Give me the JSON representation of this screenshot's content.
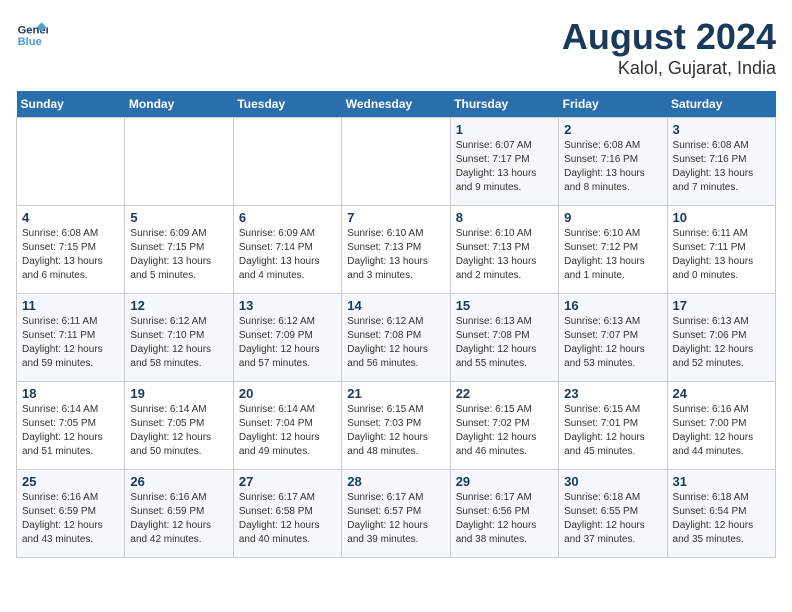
{
  "header": {
    "logo_line1": "General",
    "logo_line2": "Blue",
    "title": "August 2024",
    "subtitle": "Kalol, Gujarat, India"
  },
  "weekdays": [
    "Sunday",
    "Monday",
    "Tuesday",
    "Wednesday",
    "Thursday",
    "Friday",
    "Saturday"
  ],
  "weeks": [
    [
      {
        "day": "",
        "info": ""
      },
      {
        "day": "",
        "info": ""
      },
      {
        "day": "",
        "info": ""
      },
      {
        "day": "",
        "info": ""
      },
      {
        "day": "1",
        "info": "Sunrise: 6:07 AM\nSunset: 7:17 PM\nDaylight: 13 hours\nand 9 minutes."
      },
      {
        "day": "2",
        "info": "Sunrise: 6:08 AM\nSunset: 7:16 PM\nDaylight: 13 hours\nand 8 minutes."
      },
      {
        "day": "3",
        "info": "Sunrise: 6:08 AM\nSunset: 7:16 PM\nDaylight: 13 hours\nand 7 minutes."
      }
    ],
    [
      {
        "day": "4",
        "info": "Sunrise: 6:08 AM\nSunset: 7:15 PM\nDaylight: 13 hours\nand 6 minutes."
      },
      {
        "day": "5",
        "info": "Sunrise: 6:09 AM\nSunset: 7:15 PM\nDaylight: 13 hours\nand 5 minutes."
      },
      {
        "day": "6",
        "info": "Sunrise: 6:09 AM\nSunset: 7:14 PM\nDaylight: 13 hours\nand 4 minutes."
      },
      {
        "day": "7",
        "info": "Sunrise: 6:10 AM\nSunset: 7:13 PM\nDaylight: 13 hours\nand 3 minutes."
      },
      {
        "day": "8",
        "info": "Sunrise: 6:10 AM\nSunset: 7:13 PM\nDaylight: 13 hours\nand 2 minutes."
      },
      {
        "day": "9",
        "info": "Sunrise: 6:10 AM\nSunset: 7:12 PM\nDaylight: 13 hours\nand 1 minute."
      },
      {
        "day": "10",
        "info": "Sunrise: 6:11 AM\nSunset: 7:11 PM\nDaylight: 13 hours\nand 0 minutes."
      }
    ],
    [
      {
        "day": "11",
        "info": "Sunrise: 6:11 AM\nSunset: 7:11 PM\nDaylight: 12 hours\nand 59 minutes."
      },
      {
        "day": "12",
        "info": "Sunrise: 6:12 AM\nSunset: 7:10 PM\nDaylight: 12 hours\nand 58 minutes."
      },
      {
        "day": "13",
        "info": "Sunrise: 6:12 AM\nSunset: 7:09 PM\nDaylight: 12 hours\nand 57 minutes."
      },
      {
        "day": "14",
        "info": "Sunrise: 6:12 AM\nSunset: 7:08 PM\nDaylight: 12 hours\nand 56 minutes."
      },
      {
        "day": "15",
        "info": "Sunrise: 6:13 AM\nSunset: 7:08 PM\nDaylight: 12 hours\nand 55 minutes."
      },
      {
        "day": "16",
        "info": "Sunrise: 6:13 AM\nSunset: 7:07 PM\nDaylight: 12 hours\nand 53 minutes."
      },
      {
        "day": "17",
        "info": "Sunrise: 6:13 AM\nSunset: 7:06 PM\nDaylight: 12 hours\nand 52 minutes."
      }
    ],
    [
      {
        "day": "18",
        "info": "Sunrise: 6:14 AM\nSunset: 7:05 PM\nDaylight: 12 hours\nand 51 minutes."
      },
      {
        "day": "19",
        "info": "Sunrise: 6:14 AM\nSunset: 7:05 PM\nDaylight: 12 hours\nand 50 minutes."
      },
      {
        "day": "20",
        "info": "Sunrise: 6:14 AM\nSunset: 7:04 PM\nDaylight: 12 hours\nand 49 minutes."
      },
      {
        "day": "21",
        "info": "Sunrise: 6:15 AM\nSunset: 7:03 PM\nDaylight: 12 hours\nand 48 minutes."
      },
      {
        "day": "22",
        "info": "Sunrise: 6:15 AM\nSunset: 7:02 PM\nDaylight: 12 hours\nand 46 minutes."
      },
      {
        "day": "23",
        "info": "Sunrise: 6:15 AM\nSunset: 7:01 PM\nDaylight: 12 hours\nand 45 minutes."
      },
      {
        "day": "24",
        "info": "Sunrise: 6:16 AM\nSunset: 7:00 PM\nDaylight: 12 hours\nand 44 minutes."
      }
    ],
    [
      {
        "day": "25",
        "info": "Sunrise: 6:16 AM\nSunset: 6:59 PM\nDaylight: 12 hours\nand 43 minutes."
      },
      {
        "day": "26",
        "info": "Sunrise: 6:16 AM\nSunset: 6:59 PM\nDaylight: 12 hours\nand 42 minutes."
      },
      {
        "day": "27",
        "info": "Sunrise: 6:17 AM\nSunset: 6:58 PM\nDaylight: 12 hours\nand 40 minutes."
      },
      {
        "day": "28",
        "info": "Sunrise: 6:17 AM\nSunset: 6:57 PM\nDaylight: 12 hours\nand 39 minutes."
      },
      {
        "day": "29",
        "info": "Sunrise: 6:17 AM\nSunset: 6:56 PM\nDaylight: 12 hours\nand 38 minutes."
      },
      {
        "day": "30",
        "info": "Sunrise: 6:18 AM\nSunset: 6:55 PM\nDaylight: 12 hours\nand 37 minutes."
      },
      {
        "day": "31",
        "info": "Sunrise: 6:18 AM\nSunset: 6:54 PM\nDaylight: 12 hours\nand 35 minutes."
      }
    ]
  ]
}
